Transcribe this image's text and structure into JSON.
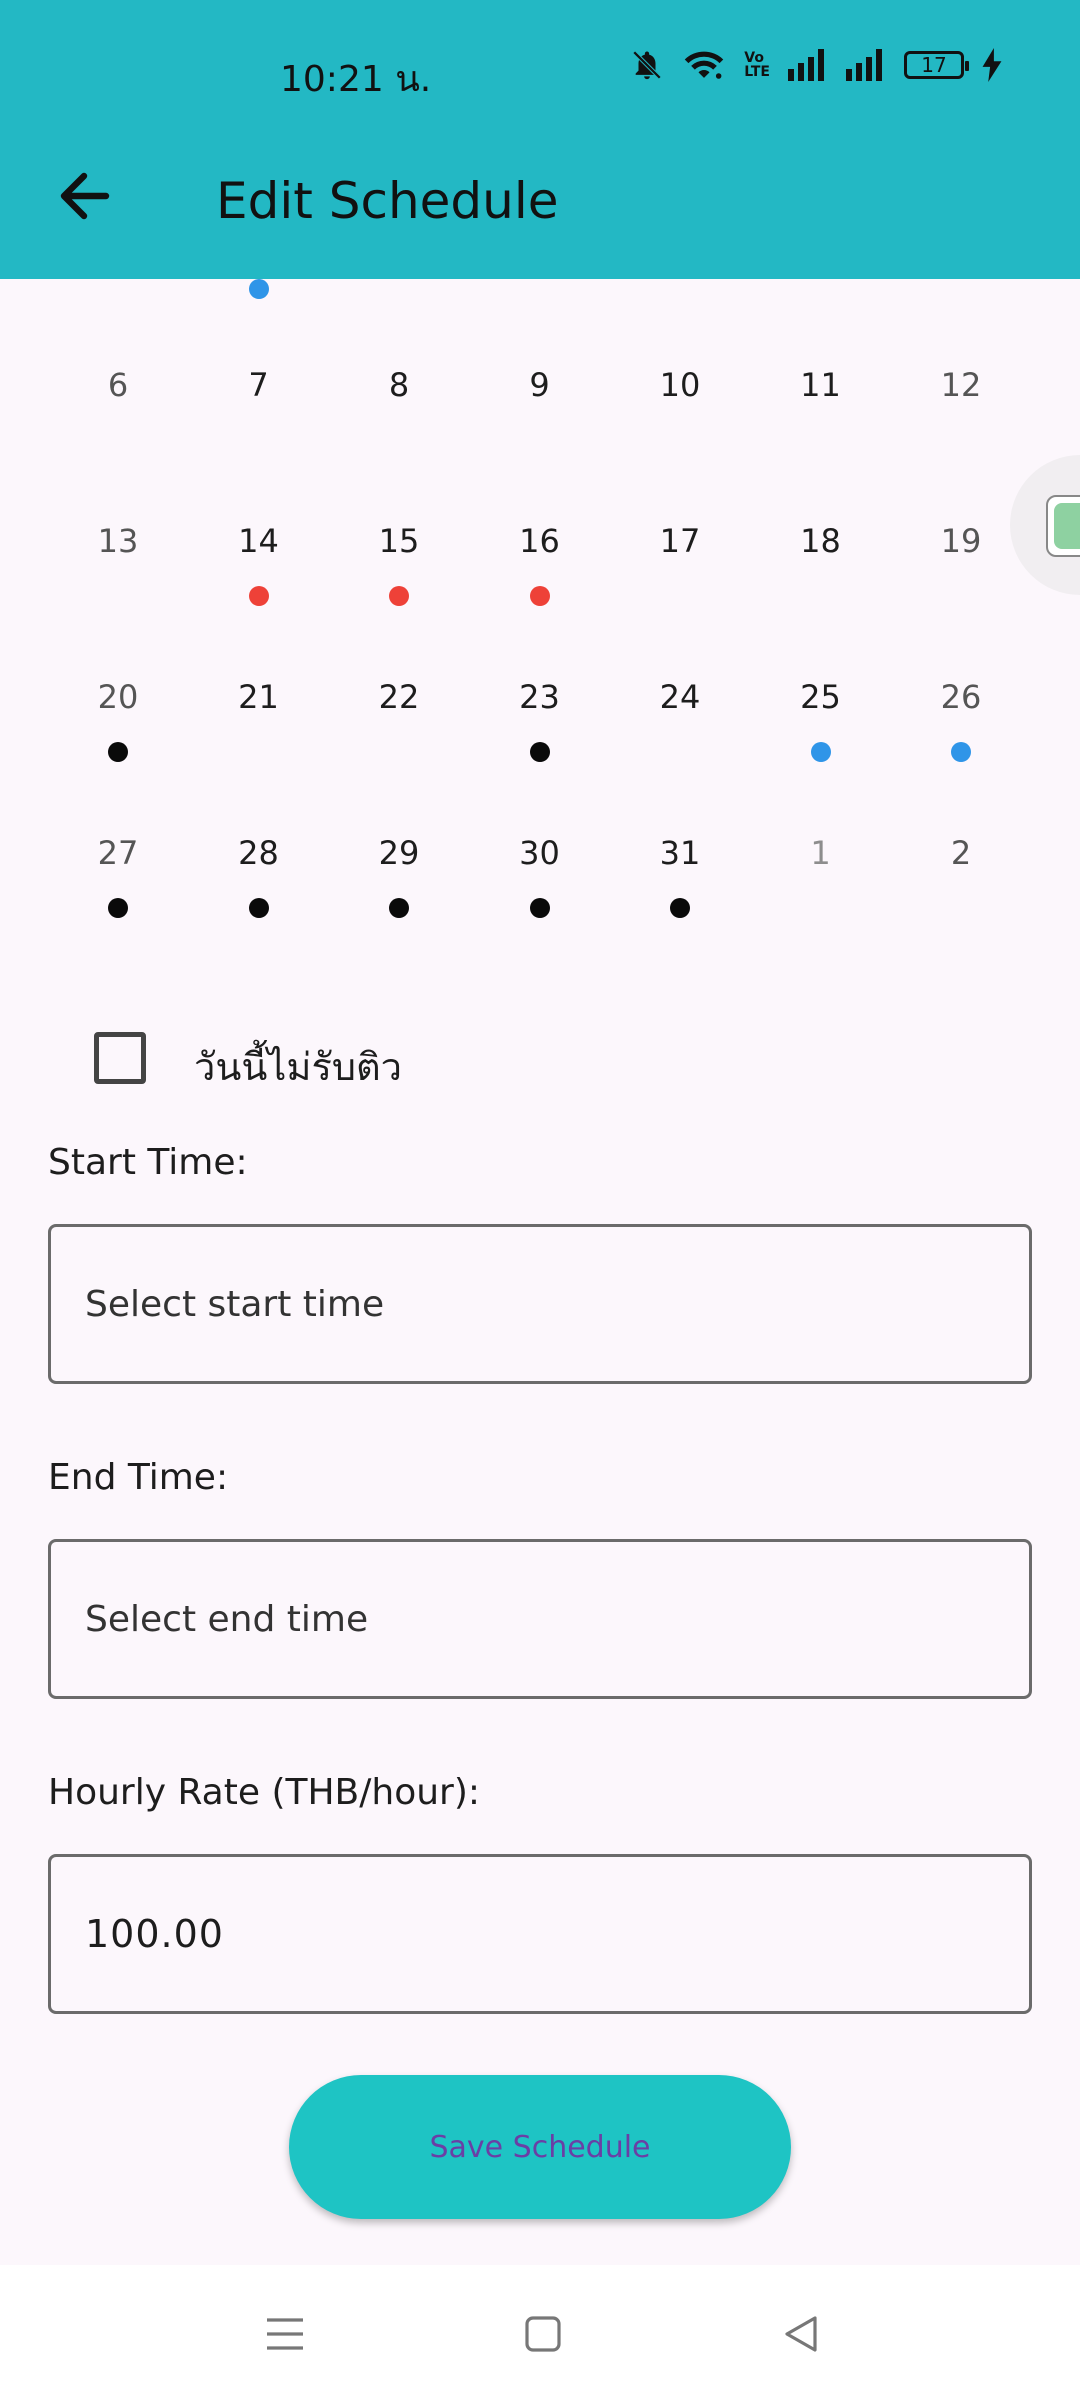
{
  "status_bar": {
    "time": "10:21 น.",
    "battery": "17",
    "icons": [
      "bell-off-icon",
      "wifi-icon",
      "volte-icon",
      "signal-icon",
      "signal-icon-2",
      "battery-icon",
      "charging-icon"
    ]
  },
  "header": {
    "title": "Edit Schedule",
    "background": "#23b8c4"
  },
  "calendar": {
    "weeks": [
      [
        {
          "n": "6"
        },
        {
          "n": "7"
        },
        {
          "n": "8"
        },
        {
          "n": "9"
        },
        {
          "n": "10"
        },
        {
          "n": "11"
        },
        {
          "n": "12"
        }
      ],
      [
        {
          "n": "13"
        },
        {
          "n": "14",
          "dot": "red"
        },
        {
          "n": "15",
          "dot": "red"
        },
        {
          "n": "16",
          "dot": "red"
        },
        {
          "n": "17"
        },
        {
          "n": "18"
        },
        {
          "n": "19"
        }
      ],
      [
        {
          "n": "20",
          "dot": "black"
        },
        {
          "n": "21"
        },
        {
          "n": "22"
        },
        {
          "n": "23",
          "dot": "black"
        },
        {
          "n": "24"
        },
        {
          "n": "25",
          "dot": "blue"
        },
        {
          "n": "26",
          "dot": "blue"
        }
      ],
      [
        {
          "n": "27",
          "dot": "black"
        },
        {
          "n": "28",
          "dot": "black"
        },
        {
          "n": "29",
          "dot": "black"
        },
        {
          "n": "30",
          "dot": "black"
        },
        {
          "n": "31",
          "dot": "black"
        },
        {
          "n": "1",
          "muted": true
        },
        {
          "n": "2",
          "muted": true
        }
      ]
    ],
    "dot_colors": {
      "red": "#ee4138",
      "blue": "#2f95e8",
      "black": "#0a0a0a"
    }
  },
  "day_off": {
    "label": "วันนี้ไม่รับติว",
    "checked": false
  },
  "start_time": {
    "label": "Start Time:",
    "placeholder": "Select start time"
  },
  "end_time": {
    "label": "End Time:",
    "placeholder": "Select end time"
  },
  "hourly_rate": {
    "label": "Hourly Rate (THB/hour):",
    "value": "100.00"
  },
  "save_button": {
    "label": "Save Schedule",
    "color": "#1ec4c4"
  }
}
